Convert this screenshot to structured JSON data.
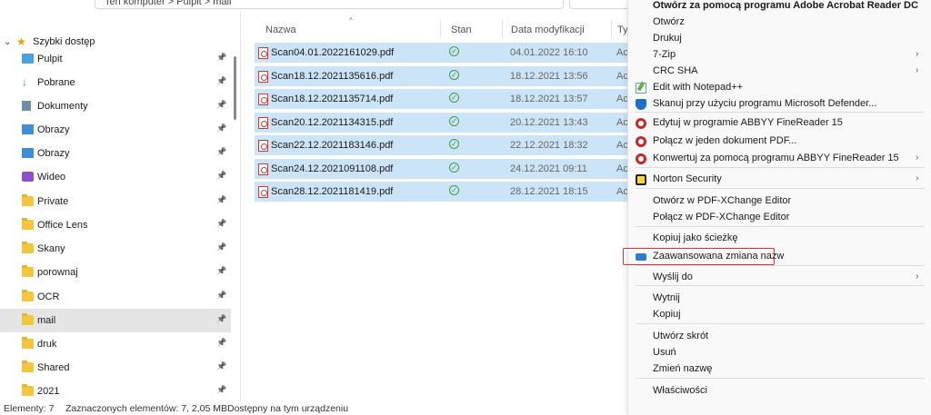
{
  "address": {
    "path_text": "Ten komputer > Pulpit > mail"
  },
  "sidebar": {
    "quick_access": "Szybki dostęp",
    "items": [
      {
        "label": "Pulpit",
        "icon": "desktop-icon"
      },
      {
        "label": "Pobrane",
        "icon": "download-icon"
      },
      {
        "label": "Dokumenty",
        "icon": "documents-icon"
      },
      {
        "label": "Obrazy",
        "icon": "pictures-icon"
      },
      {
        "label": "Obrazy",
        "icon": "pictures-icon"
      },
      {
        "label": "Wideo",
        "icon": "video-icon"
      },
      {
        "label": "Private",
        "icon": "folder-icon"
      },
      {
        "label": "Office Lens",
        "icon": "folder-icon"
      },
      {
        "label": "Skany",
        "icon": "folder-icon"
      },
      {
        "label": "porownaj",
        "icon": "folder-icon"
      },
      {
        "label": "OCR",
        "icon": "folder-icon"
      },
      {
        "label": "mail",
        "icon": "folder-icon",
        "selected": true
      },
      {
        "label": "druk",
        "icon": "folder-icon"
      },
      {
        "label": "Shared",
        "icon": "folder-icon"
      },
      {
        "label": "2021",
        "icon": "folder-icon"
      }
    ]
  },
  "columns": {
    "name": "Nazwa",
    "status": "Stan",
    "date": "Data modyfikacji",
    "type": "Ty"
  },
  "files": [
    {
      "name": "Scan04.01.2022161029.pdf",
      "date": "04.01.2022 16:10",
      "type": "Ac"
    },
    {
      "name": "Scan18.12.2021135616.pdf",
      "date": "18.12.2021 13:56",
      "type": "Ac"
    },
    {
      "name": "Scan18.12.2021135714.pdf",
      "date": "18.12.2021 13:57",
      "type": "Ac"
    },
    {
      "name": "Scan20.12.2021134315.pdf",
      "date": "20.12.2021 13:43",
      "type": "Ac"
    },
    {
      "name": "Scan22.12.2021183146.pdf",
      "date": "22.12.2021 18:32",
      "type": "Ac"
    },
    {
      "name": "Scan24.12.2021091108.pdf",
      "date": "24.12.2021 09:11",
      "type": "Ac"
    },
    {
      "name": "Scan28.12.2021181419.pdf",
      "date": "28.12.2021 18:15",
      "type": "Ac"
    }
  ],
  "status": {
    "elements": "Elementy: 7",
    "selected": "Zaznaczonych elementów: 7, 2,05 MB",
    "availability": "Dostępny na tym urządzeniu"
  },
  "context_menu": {
    "items": [
      {
        "label": "Otwórz za pomocą programu Adobe Acrobat Reader DC",
        "bold": true
      },
      {
        "label": "Otwórz"
      },
      {
        "label": "Drukuj"
      },
      {
        "label": "7-Zip",
        "submenu": true
      },
      {
        "label": "CRC SHA",
        "submenu": true
      },
      {
        "label": "Edit with Notepad++",
        "icon": "notepadpp-icon"
      },
      {
        "label": "Skanuj przy użyciu programu Microsoft Defender...",
        "icon": "defender-shield-icon"
      },
      {
        "label": "Edytuj w programie ABBYY FineReader 15",
        "icon": "abbyy-icon"
      },
      {
        "label": "Połącz w jeden dokument PDF...",
        "icon": "abbyy-icon"
      },
      {
        "label": "Konwertuj za pomocą programu ABBYY FineReader 15",
        "icon": "abbyy-icon",
        "submenu": true
      },
      {
        "label": "Norton Security",
        "icon": "norton-icon",
        "submenu": true
      },
      {
        "label": "Otwórz w PDF-XChange Editor"
      },
      {
        "label": "Połącz w PDF-XChange Editor"
      },
      {
        "label": "Kopiuj jako ścieżkę"
      },
      {
        "label": "Zaawansowana zmiana nazw",
        "icon": "powertoys-icon"
      },
      {
        "label": "Wyślij do",
        "submenu": true
      },
      {
        "label": "Wytnij"
      },
      {
        "label": "Kopiuj"
      },
      {
        "label": "Utwórz skrót"
      },
      {
        "label": "Usuń"
      },
      {
        "label": "Zmień nazwę"
      },
      {
        "label": "Właściwości"
      }
    ]
  }
}
